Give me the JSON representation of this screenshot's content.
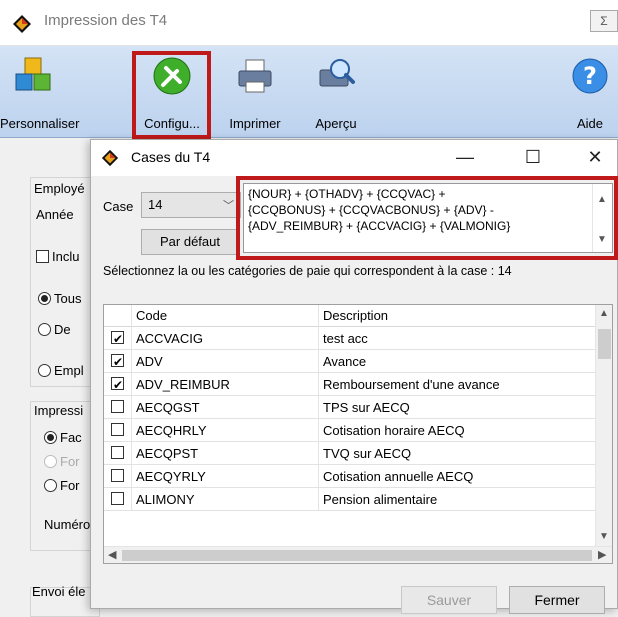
{
  "outer_window": {
    "title": "Impression des T4",
    "close_glyph": "Σ",
    "ribbon": [
      {
        "label": "Personnaliser",
        "icon": "customize-cubes-icon"
      },
      {
        "label": "Configu...",
        "icon": "configure-tools-icon"
      },
      {
        "label": "Imprimer",
        "icon": "printer-icon"
      },
      {
        "label": "Aperçu",
        "icon": "print-preview-icon"
      },
      {
        "label": "Aide",
        "icon": "help-icon"
      }
    ],
    "body": {
      "employes_group": "Employé",
      "annee": "Année",
      "inclure": "Inclu",
      "tous": "Tous",
      "de": "De",
      "empl": "Empl",
      "impression_group": "Impressi",
      "fac": "Fac",
      "for1": "For",
      "for2": "For",
      "numero": "Numéro",
      "envoi": "Envoi éle"
    }
  },
  "dialog": {
    "title": "Cases du T4",
    "window_buttons": {
      "minimize": "—",
      "maximize": "☐",
      "close": "✕"
    },
    "case_label": "Case",
    "case_value": "14",
    "default_button": "Par défaut",
    "formula_lines": [
      "{NOUR} + {OTHADV} + {CCQVAC} +",
      "{CCQBONUS} + {CCQVACBONUS} + {ADV} -",
      "{ADV_REIMBUR} + {ACCVACIG} + {VALMONIG}"
    ],
    "instructions": "Sélectionnez la ou les catégories de paie qui correspondent à la case : 14",
    "table": {
      "headers": [
        "",
        "Code",
        "Description"
      ],
      "rows": [
        {
          "checked": true,
          "code": "ACCVACIG",
          "description": "test acc"
        },
        {
          "checked": true,
          "code": "ADV",
          "description": "Avance"
        },
        {
          "checked": true,
          "code": "ADV_REIMBUR",
          "description": "Remboursement d'une avance"
        },
        {
          "checked": false,
          "code": "AECQGST",
          "description": "TPS sur AECQ"
        },
        {
          "checked": false,
          "code": "AECQHRLY",
          "description": "Cotisation horaire AECQ"
        },
        {
          "checked": false,
          "code": "AECQPST",
          "description": "TVQ sur AECQ"
        },
        {
          "checked": false,
          "code": "AECQYRLY",
          "description": "Cotisation annuelle AECQ"
        },
        {
          "checked": false,
          "code": "ALIMONY",
          "description": "Pension alimentaire"
        }
      ]
    },
    "save_button": "Sauver",
    "close_button": "Fermer"
  },
  "colors": {
    "highlight": "#c01919",
    "ribbon": "#c7daf2"
  }
}
